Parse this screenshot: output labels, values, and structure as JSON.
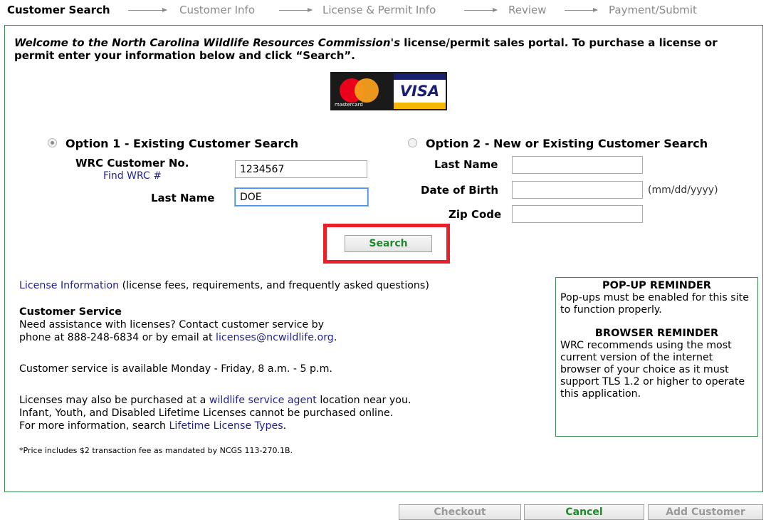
{
  "breadcrumb": {
    "steps": [
      "Customer Search",
      "Customer Info",
      "License & Permit Info",
      "Review",
      "Payment/Submit"
    ]
  },
  "welcome": {
    "italic_part": "Welcome to the North Carolina Wildlife Resources Commission's",
    "rest": " license/permit sales portal. To purchase a license or permit enter your information below and click “Search”."
  },
  "cards": {
    "mastercard_text": "mastercard",
    "visa_text": "VISA"
  },
  "option1": {
    "title": "Option 1 - Existing Customer Search",
    "selected": true,
    "customer_no_label": "WRC Customer No.",
    "find_link": "Find WRC #",
    "customer_no_value": "1234567",
    "last_name_label": "Last Name",
    "last_name_value": "DOE"
  },
  "option2": {
    "title": "Option 2 - New or Existing Customer Search",
    "selected": false,
    "last_name_label": "Last Name",
    "dob_label": "Date of Birth",
    "dob_hint": "(mm/dd/yyyy)",
    "zip_label": "Zip Code"
  },
  "search_button": "Search",
  "info": {
    "license_link": "License Information",
    "license_desc": " (license fees, requirements, and frequently asked questions)",
    "cs_title": "Customer Service",
    "cs_line1": "Need assistance with licenses? Contact customer service by",
    "cs_line2_pre": "phone at 888-248-6834 or by email at ",
    "cs_email": "licenses@ncwildlife.org",
    "cs_line2_post": ".",
    "hours": "Customer service is available Monday - Friday, 8 a.m. - 5 p.m.",
    "agent_pre": "Licenses may also be purchased at a ",
    "agent_link": "wildlife service agent",
    "agent_post": " location near you.",
    "lifetime_line": "Infant, Youth, and Disabled Lifetime Licenses cannot be purchased online.",
    "more_pre": "For more information, search ",
    "more_link": "Lifetime License Types",
    "more_post": ".",
    "footnote": "*Price includes $2 transaction fee as mandated by NCGS 113-270.1B."
  },
  "reminder": {
    "popup_title": "POP-UP REMINDER",
    "popup_text": "Pop-ups must be enabled for this site to function properly.",
    "browser_title": "BROWSER REMINDER",
    "browser_text": "WRC recommends using the most current version of the internet browser of your choice as it must support TLS 1.2 or higher to operate this application."
  },
  "footer_buttons": {
    "checkout": "Checkout",
    "cancel": "Cancel",
    "add_customer": "Add Customer"
  },
  "colors": {
    "border_green": "#3a8b4f",
    "highlight_red": "#e8202a",
    "link_blue": "#1f1f8f",
    "button_green": "#1e8a2c"
  }
}
